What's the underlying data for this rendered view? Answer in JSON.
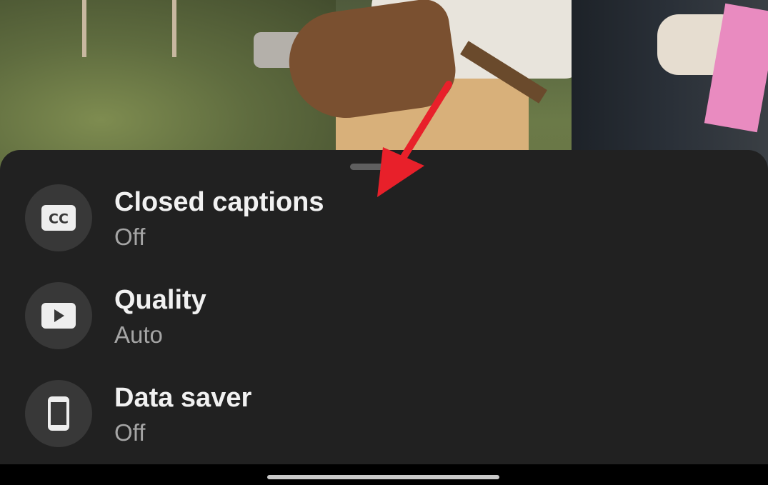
{
  "settings_sheet": {
    "items": [
      {
        "title": "Closed captions",
        "value": "Off",
        "icon": "closed-captions-icon"
      },
      {
        "title": "Quality",
        "value": "Auto",
        "icon": "play-icon"
      },
      {
        "title": "Data saver",
        "value": "Off",
        "icon": "phone-icon"
      }
    ]
  },
  "colors": {
    "sheet_background": "#212121",
    "icon_circle": "#383838",
    "title_text": "#f1f1f1",
    "value_text": "#a5a5a5",
    "annotation_arrow": "#e8202a"
  }
}
